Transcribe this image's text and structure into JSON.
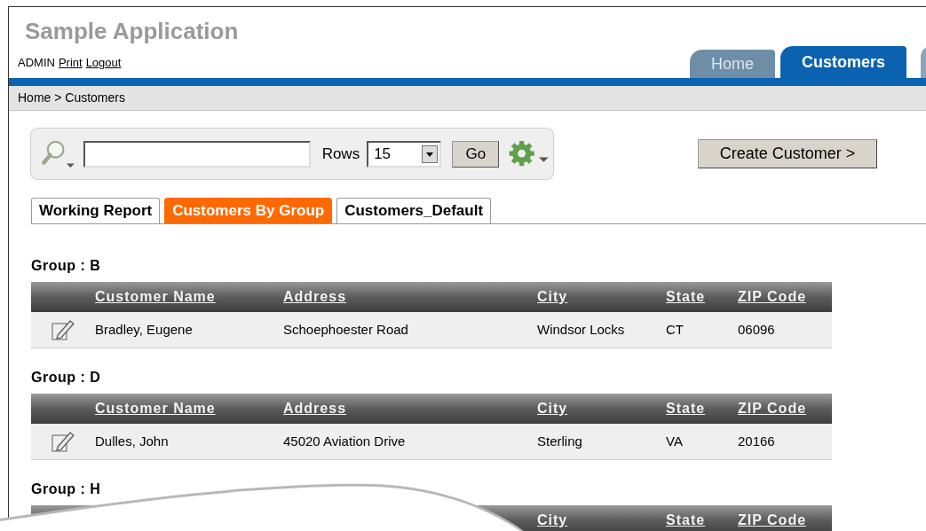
{
  "app_title": "Sample Application",
  "user_links": [
    {
      "label": "ADMIN",
      "kind": "text"
    },
    {
      "label": "Print",
      "kind": "link"
    },
    {
      "label": "Logout",
      "kind": "link"
    }
  ],
  "tabs": [
    {
      "label": "Home",
      "selected": false
    },
    {
      "label": "Customers",
      "selected": true
    }
  ],
  "breadcrumb": "Home > Customers",
  "search_bar": {
    "rows_label": "Rows",
    "rows_value": "15",
    "go_button": "Go"
  },
  "create_button": "Create Customer >",
  "report_tabs": [
    {
      "label": "Working Report",
      "selected": false
    },
    {
      "label": "Customers By Group",
      "selected": true
    },
    {
      "label": "Customers_Default",
      "selected": false
    }
  ],
  "groups": [
    {
      "title": "Group : B",
      "columns": [
        "Customer Name",
        "Address",
        "City",
        "State",
        "ZIP Code"
      ],
      "rows": [
        [
          "Bradley, Eugene",
          "Schoephoester Road",
          "Windsor Locks",
          "CT",
          "06096"
        ]
      ]
    },
    {
      "title": "Group : D",
      "columns": [
        "Customer Name",
        "Address",
        "City",
        "State",
        "ZIP Code"
      ],
      "rows": [
        [
          "Dulles, John",
          "45020 Aviation Drive",
          "Sterling",
          "VA",
          "20166"
        ]
      ]
    },
    {
      "title": "Group : H",
      "columns": [
        "City",
        "State",
        "ZIP Code"
      ]
    }
  ]
}
